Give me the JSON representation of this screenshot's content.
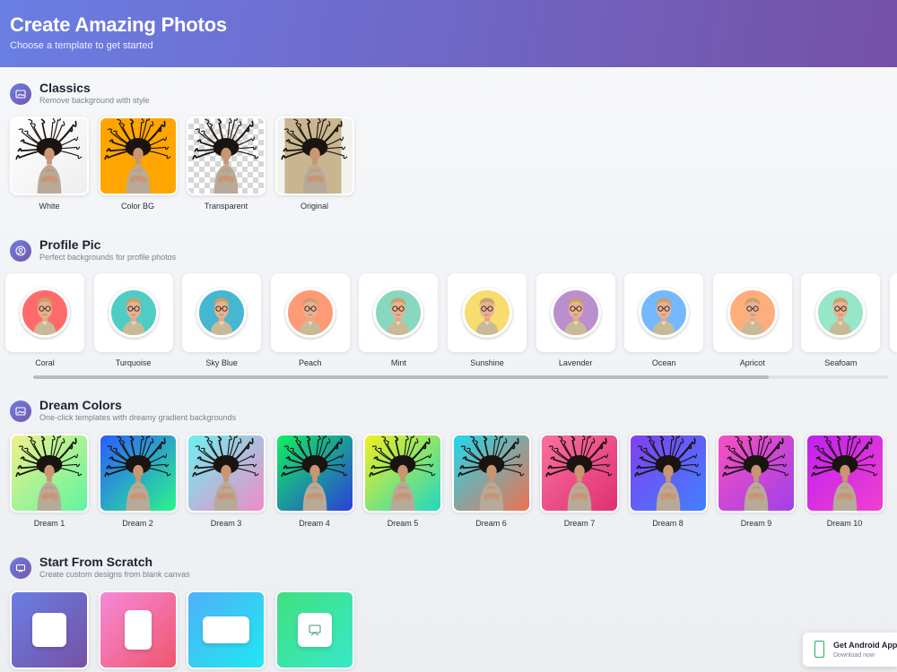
{
  "header": {
    "title": "Create Amazing Photos",
    "subtitle": "Choose a template to get started"
  },
  "classics": {
    "title": "Classics",
    "subtitle": "Remove background with style",
    "icon": "image-icon",
    "items": [
      {
        "label": "White",
        "bg": "#ffffff"
      },
      {
        "label": "Color BG",
        "bg": "#ffa500"
      },
      {
        "label": "Transparent",
        "bg": "checker"
      },
      {
        "label": "Original",
        "bg": "#c9b590"
      }
    ]
  },
  "profile": {
    "title": "Profile Pic",
    "subtitle": "Perfect backgrounds for profile photos",
    "icon": "user-circle-icon",
    "items": [
      {
        "label": "Coral",
        "color": "#ff6b6b"
      },
      {
        "label": "Turquoise",
        "color": "#4ecdc4"
      },
      {
        "label": "Sky Blue",
        "color": "#45b7d1"
      },
      {
        "label": "Peach",
        "color": "#ff9a76"
      },
      {
        "label": "Mint",
        "color": "#88d8c0"
      },
      {
        "label": "Sunshine",
        "color": "#f7dc6f"
      },
      {
        "label": "Lavender",
        "color": "#bb8fce"
      },
      {
        "label": "Ocean",
        "color": "#74b9ff"
      },
      {
        "label": "Apricot",
        "color": "#fdae7a"
      },
      {
        "label": "Seafoam",
        "color": "#96e6c8"
      }
    ]
  },
  "dream": {
    "title": "Dream Colors",
    "subtitle": "One-click templates with dreamy gradient backgrounds",
    "icon": "image-icon",
    "items": [
      {
        "label": "Dream 1",
        "g1": "#f0f08a",
        "g2": "#5ef5a0"
      },
      {
        "label": "Dream 2",
        "g1": "#2a5cff",
        "g2": "#2af58a"
      },
      {
        "label": "Dream 3",
        "g1": "#6df0f0",
        "g2": "#f08ac8"
      },
      {
        "label": "Dream 4",
        "g1": "#10f060",
        "g2": "#2a40d8"
      },
      {
        "label": "Dream 5",
        "g1": "#f0f020",
        "g2": "#20d8c0"
      },
      {
        "label": "Dream 6",
        "g1": "#20d8f0",
        "g2": "#f07050"
      },
      {
        "label": "Dream 7",
        "g1": "#f870a0",
        "g2": "#e03070"
      },
      {
        "label": "Dream 8",
        "g1": "#8040f0",
        "g2": "#4080ff"
      },
      {
        "label": "Dream 9",
        "g1": "#f850c0",
        "g2": "#a040e8"
      },
      {
        "label": "Dream 10",
        "g1": "#c020f0",
        "g2": "#f040d0"
      }
    ]
  },
  "scratch": {
    "title": "Start From Scratch",
    "subtitle": "Create custom designs from blank canvas",
    "icon": "presentation-icon",
    "items": [
      {
        "g1": "#6a7ee3",
        "g2": "#7551a6"
      },
      {
        "g1": "#f58ad8",
        "g2": "#f0556e"
      },
      {
        "g1": "#4fb0f8",
        "g2": "#20e8f0"
      },
      {
        "g1": "#40e080",
        "g2": "#38e8c8"
      }
    ]
  },
  "android": {
    "title": "Get Android App",
    "subtitle": "Download now"
  }
}
